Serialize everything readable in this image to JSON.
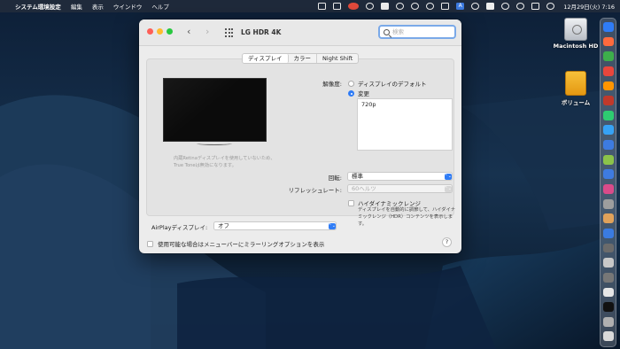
{
  "menubar": {
    "apple_glyph": "",
    "app_name": "システム環境設定",
    "items": [
      "編集",
      "表示",
      "ウインドウ",
      "ヘルプ"
    ],
    "ime_label": "A",
    "clock": "12月29日(火)  7:16"
  },
  "desktop": {
    "icons": [
      {
        "label": "Macintosh HD",
        "icon": "hard-drive-icon"
      },
      {
        "label": "ボリューム",
        "icon": "external-drive-icon"
      }
    ]
  },
  "dock": {
    "app_colors": [
      "#2f7cf6",
      "#ff6a3d",
      "#3dae4b",
      "#e8463c",
      "#ff9500",
      "#c0392b",
      "#2ecc71",
      "#36a2f5",
      "#3d7be0",
      "#8bc34a",
      "#3e7be0",
      "#d94b8a",
      "#9e9e9e",
      "#e0a25a",
      "#3a7be0",
      "#6b6b6b",
      "#c8c8c8",
      "#777777",
      "#e6e6e6",
      "#111111",
      "#b0b0b0",
      "#d9d9d9"
    ]
  },
  "window": {
    "title": "LG HDR 4K",
    "search_placeholder": "検索",
    "tabs": [
      {
        "label": "ディスプレイ",
        "active": true
      },
      {
        "label": "カラー",
        "active": false
      },
      {
        "label": "Night Shift",
        "active": false
      }
    ],
    "notice": "内蔵Retinaディスプレイを使用していないため、True Toneは無効になります。",
    "resolution": {
      "label": "解像度:",
      "options": [
        {
          "label": "ディスプレイのデフォルト",
          "selected": false
        },
        {
          "label": "変更",
          "selected": true
        }
      ],
      "list_items": [
        "720p"
      ]
    },
    "rotation": {
      "label": "回転:",
      "value": "標準"
    },
    "refresh": {
      "label": "リフレッシュレート:",
      "value": "60ヘルツ",
      "disabled": true
    },
    "hdr": {
      "label": "ハイダイナミックレンジ",
      "checked": false,
      "description": "ディスプレイを自動的に調節して、ハイダイナミックレンジ（HDR）コンテンツを表示します。"
    },
    "airplay": {
      "label": "AirPlayディスプレイ:",
      "value": "オフ"
    },
    "mirroring": {
      "label": "使用可能な場合はメニューバーにミラーリングオプションを表示",
      "checked": false
    },
    "help": "?",
    "icons": {
      "back": "‹",
      "forward": "›",
      "chevron": "⌃⌄"
    }
  }
}
